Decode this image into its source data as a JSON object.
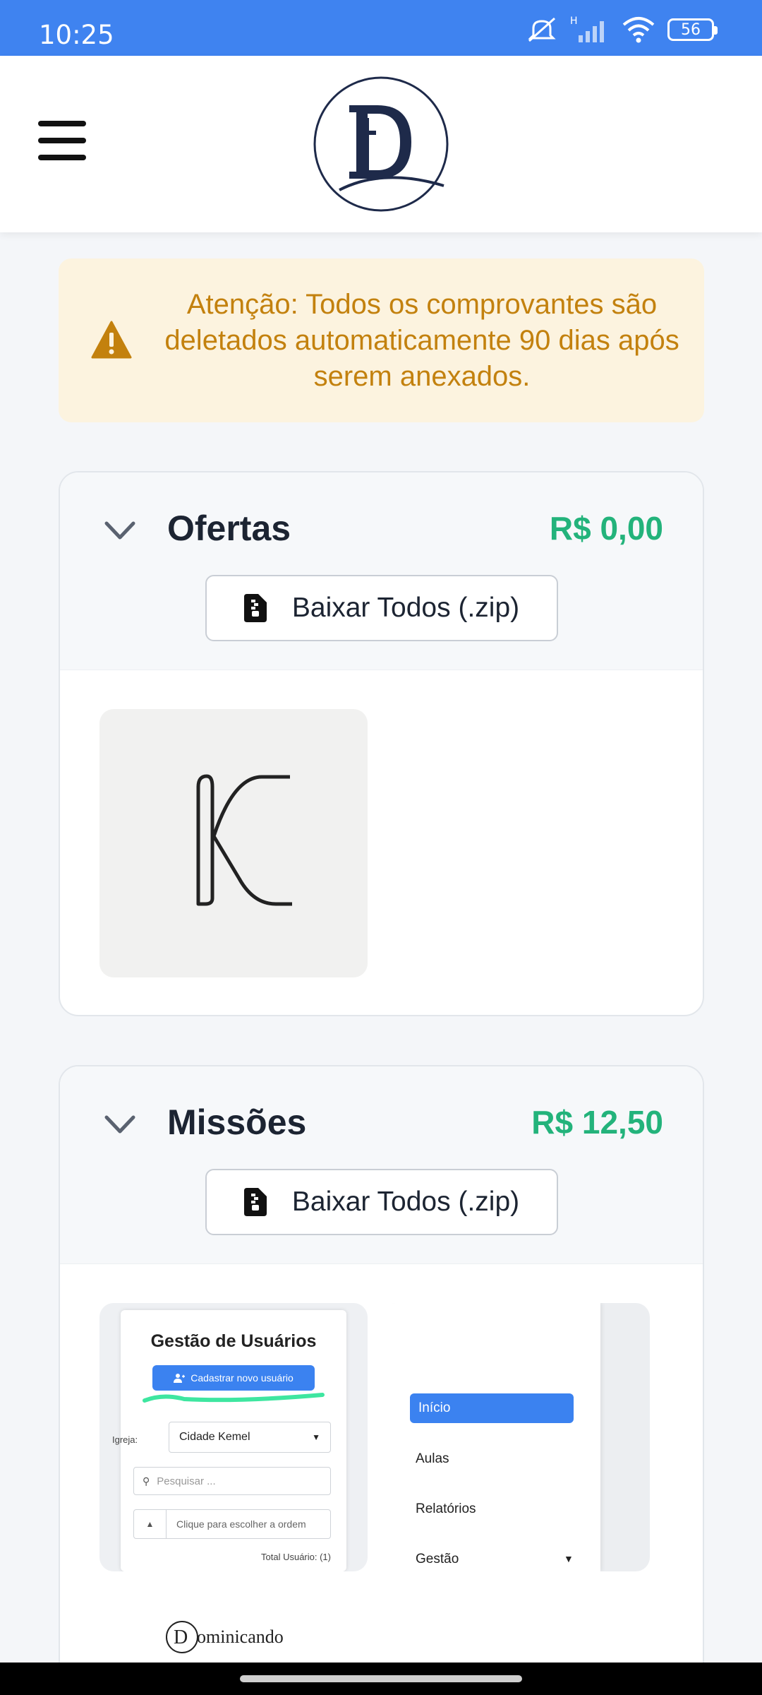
{
  "status_bar": {
    "time": "10:25",
    "battery": "56",
    "icons": [
      "mute-icon",
      "signal-icon",
      "wifi-icon",
      "battery-icon"
    ]
  },
  "header": {
    "menu_icon": "hamburger-menu-icon",
    "logo": "dominicando-logo"
  },
  "alert": {
    "icon": "warning-triangle-icon",
    "message": "Atenção: Todos os comprovantes são deletados automaticamente 90 dias após serem anexados."
  },
  "sections": [
    {
      "title": "Ofertas",
      "amount": "R$ 0,00",
      "download_label": "Baixar Todos (.zip)"
    },
    {
      "title": "Missões",
      "amount": "R$ 12,50",
      "download_label": "Baixar Todos (.zip)"
    }
  ],
  "thumb_users": {
    "title": "Gestão de Usuários",
    "button": "Cadastrar novo usuário",
    "church_label": "Igreja:",
    "church_value": "Cidade Kemel",
    "search_placeholder": "Pesquisar ...",
    "order_placeholder": "Clique para escolher a ordem",
    "total": "Total Usuário: (1)"
  },
  "thumb_menu": {
    "items": [
      "Início",
      "Aulas",
      "Relatórios",
      "Gestão"
    ]
  },
  "thumb_brand": {
    "text": "ominicando"
  },
  "colors": {
    "status_bar": "#3f83f0",
    "alert_bg": "#fcf3df",
    "alert_text": "#c3810e",
    "amount": "#23b37b",
    "title": "#1c2432"
  }
}
